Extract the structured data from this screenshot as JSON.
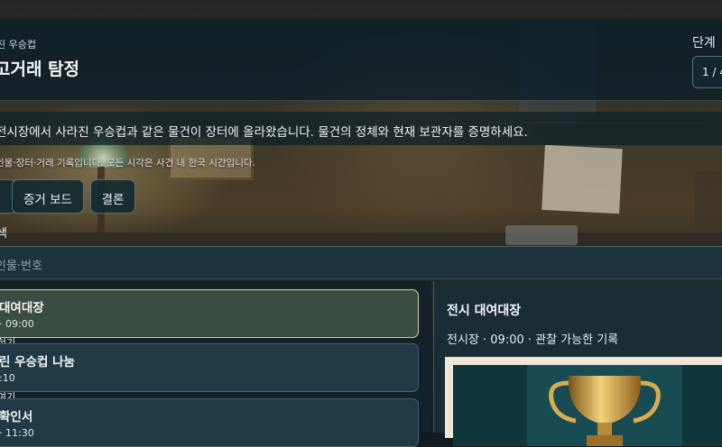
{
  "case": {
    "subtitle": "진 우승컵",
    "title": "고거래 탐정",
    "stage_label": "단계",
    "stage_value": "1 / 4"
  },
  "brief": "전시장에서 사라진 우승컵과 같은 물건이 장터에 올라왔습니다. 물건의 정체와 현재 보관자를 증명하세요.",
  "note": "인물·장터·거래 기록입니다. 모든 시각은 사건 내 한국 시간입니다.",
  "nav": {
    "evidence_board": "증거 보드",
    "conclusion": "결론"
  },
  "search": {
    "label": "색",
    "placeholder": "인물·번호"
  },
  "records": [
    {
      "title": "대여대장",
      "meta": "· 09:00",
      "under": "혀기"
    },
    {
      "title": "린 우승컵 나눔",
      "meta": ":10",
      "under": "여기"
    },
    {
      "title": "확인서",
      "meta": "· 11:30"
    }
  ],
  "detail": {
    "title": "전시 대여대장",
    "meta": "전시장 · 09:00 · 관찰 가능한 기록",
    "image_icon": "trophy-icon"
  },
  "colors": {
    "active_border": "#e2cd8a",
    "panel": "#1f3a44"
  }
}
